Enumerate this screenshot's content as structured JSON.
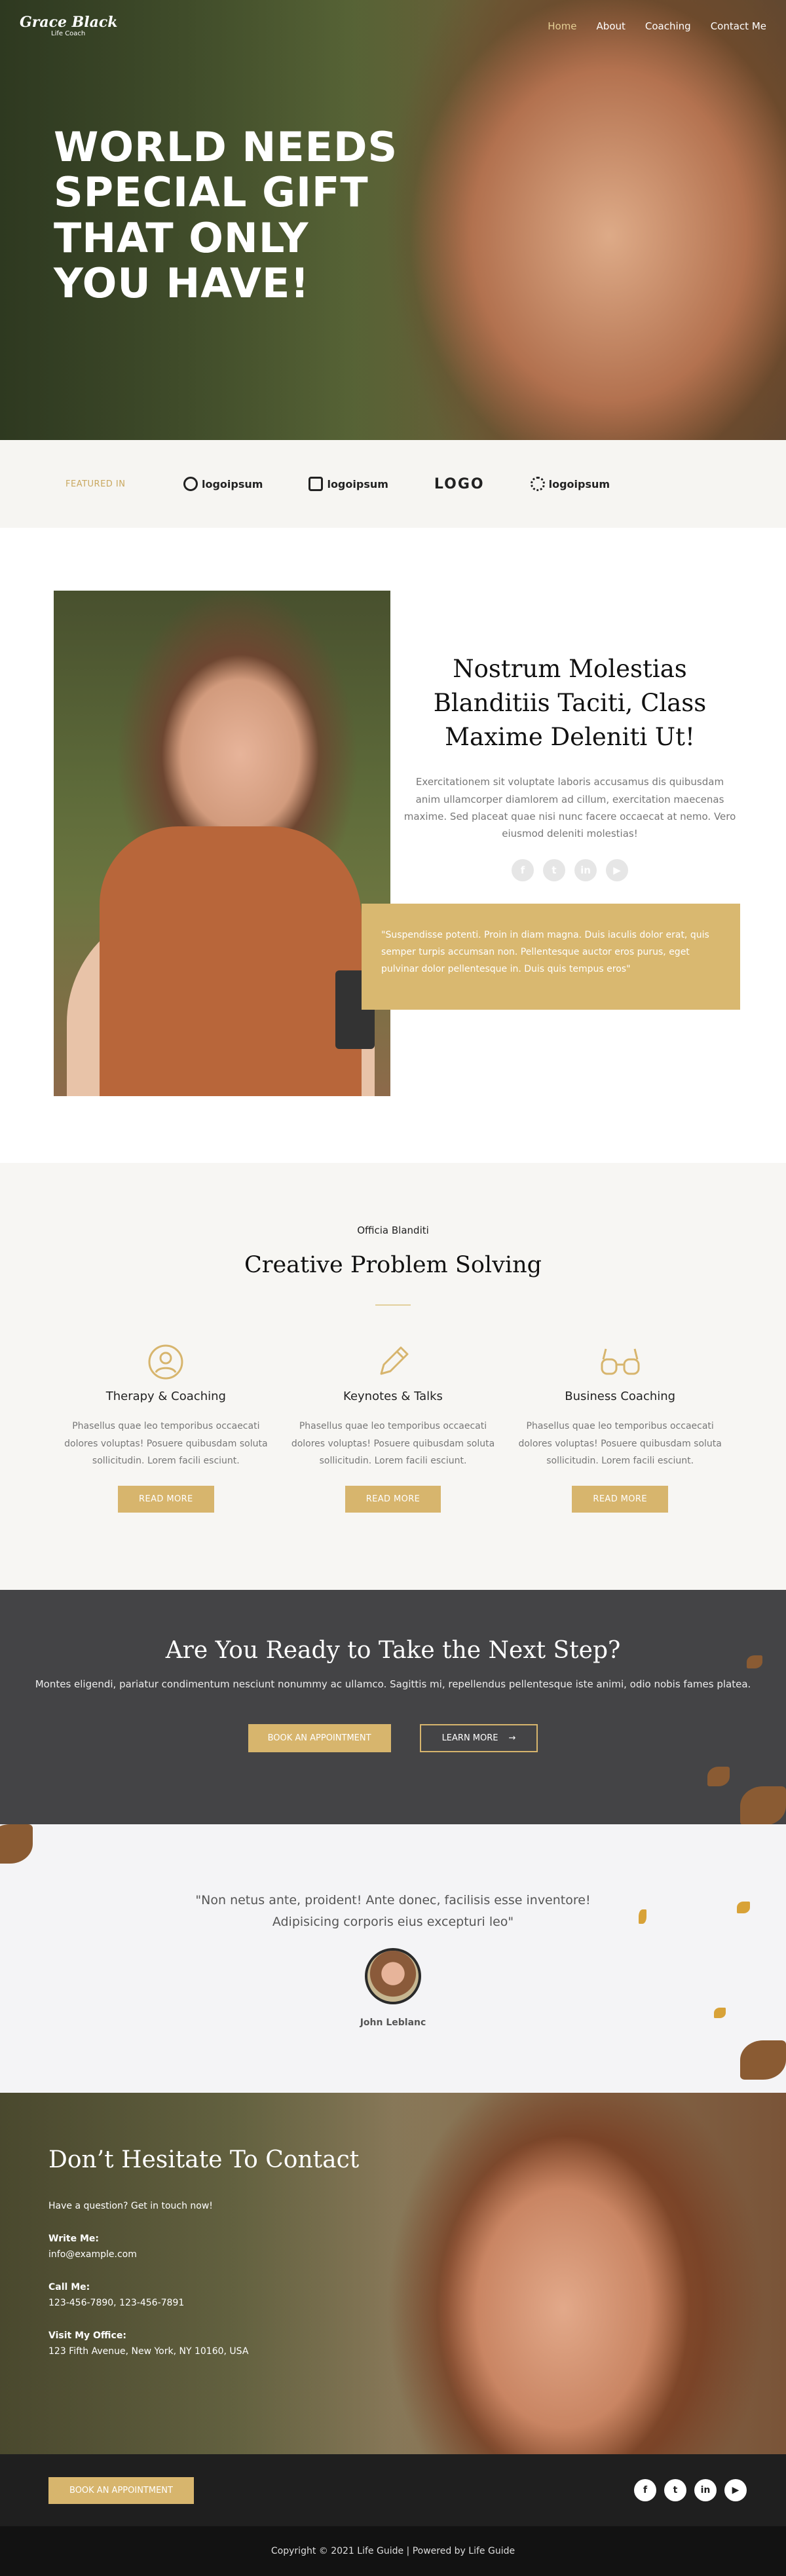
{
  "nav": {
    "logo_name": "Grace Black",
    "logo_sub": "Life Coach",
    "items": [
      "Home",
      "About",
      "Coaching",
      "Contact Me"
    ]
  },
  "hero": {
    "title": "WORLD NEEDS SPECIAL GIFT THAT ONLY YOU HAVE!"
  },
  "featured": {
    "label": "FEATURED IN",
    "logos": [
      "logoipsum",
      "logoipsum",
      "LOGO",
      "logoipsum"
    ]
  },
  "about": {
    "heading": "Nostrum Molestias Blanditiis Taciti, Class Maxime Deleniti Ut!",
    "body": "Exercitationem sit voluptate laboris accusamus dis quibusdam anim ullamcorper diamlorem ad cillum, exercitation maecenas maxime. Sed placeat quae nisi nunc facere occaecat at nemo. Vero eiusmod deleniti molestias!",
    "quote": "\"Suspendisse potenti. Proin in diam magna. Duis iaculis dolor erat, quis semper turpis accumsan non. Pellentesque auctor eros purus, eget pulvinar dolor pellentesque in. Duis quis tempus eros\""
  },
  "services": {
    "eyebrow": "Officia Blanditi",
    "heading": "Creative Problem Solving",
    "items": [
      {
        "title": "Therapy & Coaching",
        "text": "Phasellus quae leo temporibus occaecati dolores voluptas! Posuere quibusdam soluta sollicitudin. Lorem facili esciunt.",
        "button": "READ MORE"
      },
      {
        "title": "Keynotes & Talks",
        "text": "Phasellus quae leo temporibus occaecati dolores voluptas! Posuere quibusdam soluta sollicitudin. Lorem facili esciunt.",
        "button": "READ MORE"
      },
      {
        "title": "Business Coaching",
        "text": "Phasellus quae leo temporibus occaecati dolores voluptas! Posuere quibusdam soluta sollicitudin. Lorem facili esciunt.",
        "button": "READ MORE"
      }
    ]
  },
  "cta": {
    "heading": "Are You Ready to Take the Next Step?",
    "text": "Montes eligendi, pariatur condimentum nesciunt nonummy ac ullamco. Sagittis mi, repellendus pellentesque iste animi, odio nobis fames platea.",
    "primary": "BOOK AN APPOINTMENT",
    "secondary": "LEARN MORE"
  },
  "testimonial": {
    "quote": "\"Non netus ante, proident! Ante donec, facilisis esse inventore! Adipisicing corporis eius excepturi leo\"",
    "name": "John Leblanc"
  },
  "contact": {
    "heading": "Don’t Hesitate To Contact",
    "intro": "Have a question? Get in touch now!",
    "write_label": "Write Me:",
    "write_value": "info@example.com",
    "call_label": "Call Me:",
    "call_value": "123-456-7890, 123-456-7891",
    "visit_label": "Visit My Office:",
    "visit_value": "123 Fifth Avenue, New York, NY 10160, USA"
  },
  "footer": {
    "button": "BOOK AN APPOINTMENT",
    "copyright": "Copyright © 2021 Life Guide | Powered by Life Guide"
  },
  "colors": {
    "accent": "#d7b56d",
    "dark": "#444446",
    "footer": "#1f1f1f"
  }
}
